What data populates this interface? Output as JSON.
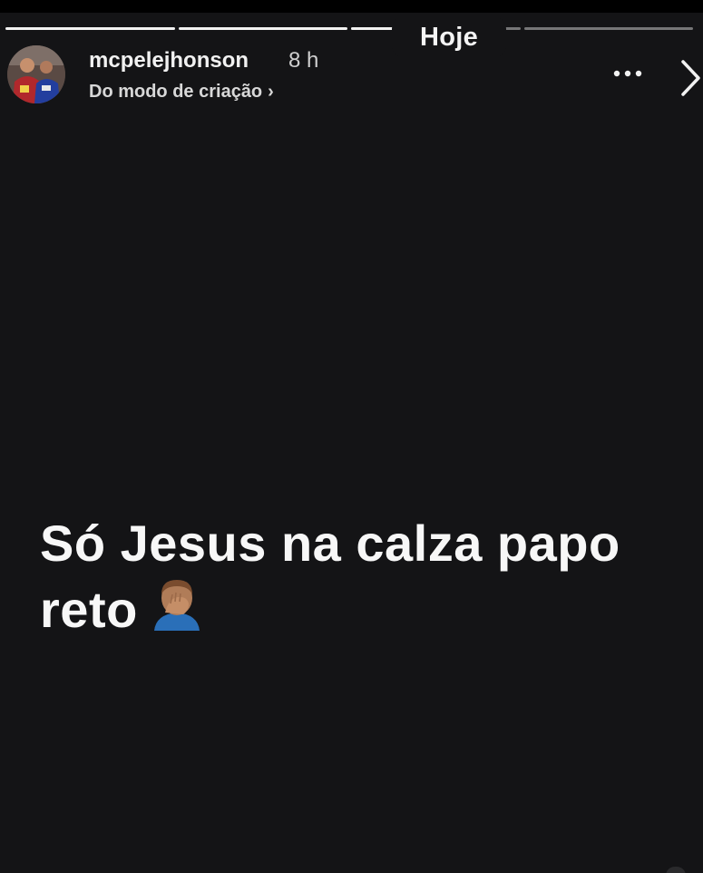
{
  "story": {
    "date_label": "Hoje",
    "progress": [
      1.0,
      1.0,
      0.55,
      0.0
    ],
    "author": {
      "username": "mcpelejhonson",
      "time_ago": "8 h",
      "source_label": "Do modo de criação",
      "source_chevron": "›"
    },
    "more_icon": "ellipsis-icon",
    "next_icon": "chevron-right-icon",
    "caption_line_1": "Só Jesus na calza papo",
    "caption_line_2": "reto",
    "caption_emoji": "man-facepalming-emoji"
  },
  "colors": {
    "background": "#141416",
    "text": "#f7f7f7",
    "secondary_text": "#cfcfcf"
  }
}
